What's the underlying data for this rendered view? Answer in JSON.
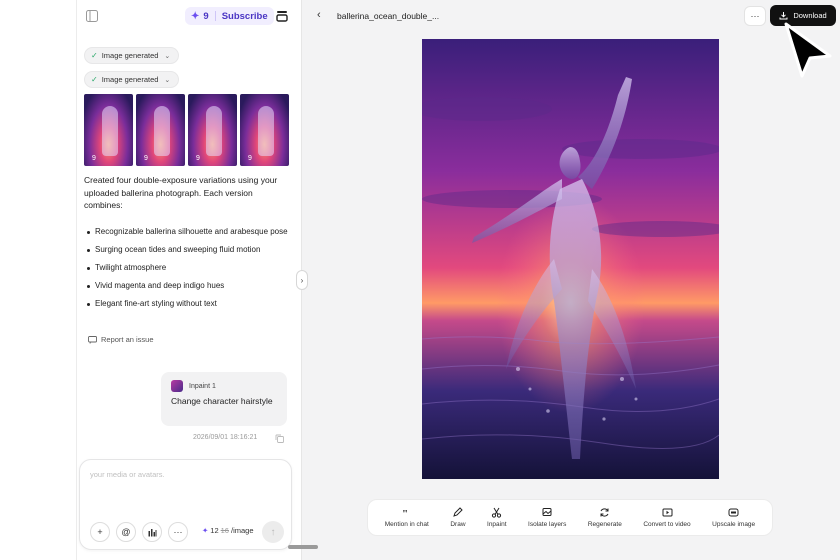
{
  "header": {
    "credits": "9",
    "subscribe_label": "Subscribe"
  },
  "chat": {
    "chips": [
      {
        "label": "Image generated"
      },
      {
        "label": "Image generated"
      }
    ],
    "thumbnails": [
      {
        "badge": "9"
      },
      {
        "badge": "9"
      },
      {
        "badge": "9"
      },
      {
        "badge": "9"
      }
    ],
    "message": "Created four double-exposure variations using your uploaded ballerina photograph. Each version combines:",
    "bullets": [
      "Recognizable ballerina silhouette and arabesque pose",
      "Surging ocean tides and sweeping fluid motion",
      "Twilight atmosphere",
      "Vivid magenta and deep indigo hues",
      "Elegant fine-art styling without text"
    ],
    "report_label": "Report an issue",
    "user_message": {
      "tag": "Inpaint 1",
      "text": "Change character hairstyle"
    },
    "timestamp": "2026/09/01 18:16:21"
  },
  "composer": {
    "placeholder": "your media or avatars.",
    "price_new": "12",
    "price_old": "16",
    "price_unit": "/image"
  },
  "preview": {
    "title": "ballerina_ocean_double_...",
    "download_label": "Download"
  },
  "toolbar": {
    "items": [
      {
        "label": "Mention in chat",
        "icon": "quote-icon"
      },
      {
        "label": "Draw",
        "icon": "pen-icon"
      },
      {
        "label": "Inpaint",
        "icon": "scissors-icon"
      },
      {
        "label": "Isolate layers",
        "icon": "layers-icon"
      },
      {
        "label": "Regenerate",
        "icon": "refresh-icon"
      },
      {
        "label": "Convert to video",
        "icon": "video-icon"
      },
      {
        "label": "Upscale image",
        "icon": "upscale-icon"
      }
    ]
  },
  "colors": {
    "accent": "#6b4ef0",
    "download_bg": "#111111",
    "panel_bg": "#ffffff",
    "canvas_bg": "#f3f3f4"
  }
}
